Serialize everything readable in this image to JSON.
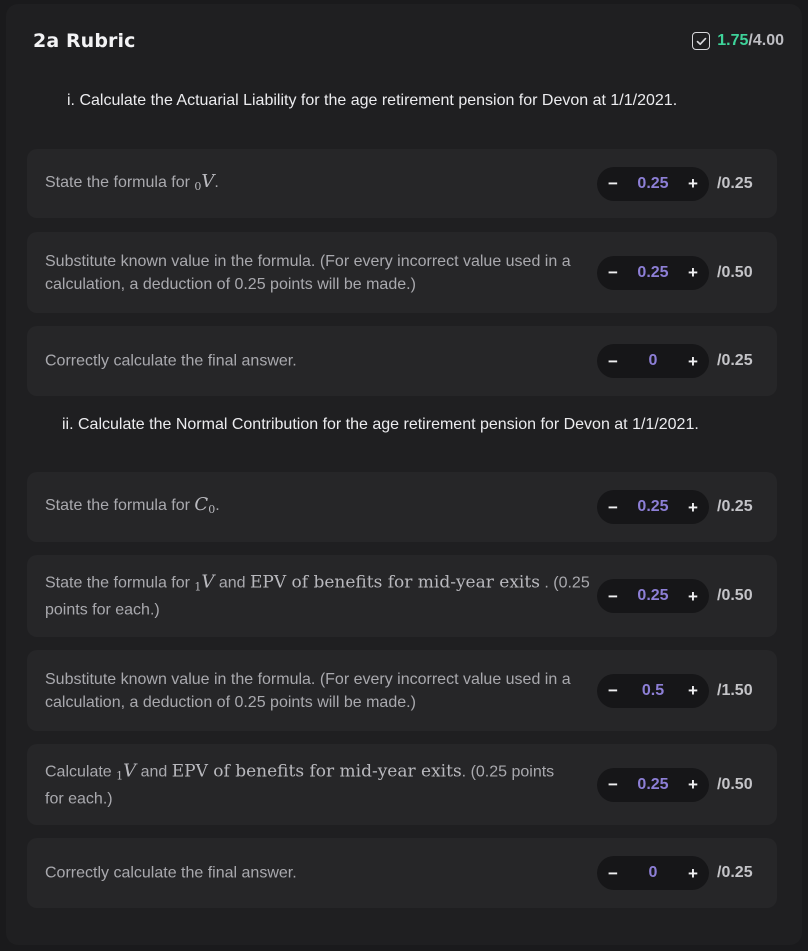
{
  "header": {
    "title": "2a Rubric",
    "score_earned": "1.75",
    "score_total": "/4.00"
  },
  "questions": {
    "q1": "i. Calculate the Actuarial Liability for the age retirement pension for Devon at 1/1/2021.",
    "q2": "ii. Calculate the Normal Contribution for the age retirement pension for Devon at 1/1/2021."
  },
  "items": [
    {
      "text_a": "State the formula for ",
      "math_sub": "0",
      "math_var": "V",
      "text_b": ".",
      "value": "0.25",
      "max": "/0.25"
    },
    {
      "text": "Substitute known value in the formula. (For every incorrect value used in a calculation, a deduction of 0.25 points will be made.)",
      "value": "0.25",
      "max": "/0.50"
    },
    {
      "text": "Correctly calculate the final answer.",
      "value": "0",
      "max": "/0.25"
    },
    {
      "text_a": "State the formula for ",
      "math_var": "C",
      "math_sub": "0",
      "text_b": ".",
      "value": "0.25",
      "max": "/0.25"
    },
    {
      "text_a": "State the formula for ",
      "math_sub": "1",
      "math_var": "V",
      "text_mid": " and ",
      "math_b": "EPV of benefits for mid-year exits",
      "text_b": " . (0.25 points for each.)",
      "value": "0.25",
      "max": "/0.50"
    },
    {
      "text": "Substitute known value in the formula. (For every incorrect value used in a calculation, a deduction of 0.25 points will be made.)",
      "value": "0.5",
      "max": "/1.50"
    },
    {
      "text_a": "Calculate ",
      "math_sub": "1",
      "math_var": "V",
      "text_mid": " and ",
      "math_b": "EPV of benefits for mid-year exits",
      "text_b": ". (0.25 points for each.)",
      "value": "0.25",
      "max": "/0.50"
    },
    {
      "text": "Correctly calculate the final answer.",
      "value": "0",
      "max": "/0.25"
    }
  ],
  "stepper": {
    "minus": "−",
    "plus": "+"
  },
  "icons": {
    "score": "checkbox-check-icon"
  },
  "colors": {
    "earned": "#3ed39a",
    "value": "#8d7fd6",
    "background": "#1f1f21",
    "row": "#262628"
  }
}
